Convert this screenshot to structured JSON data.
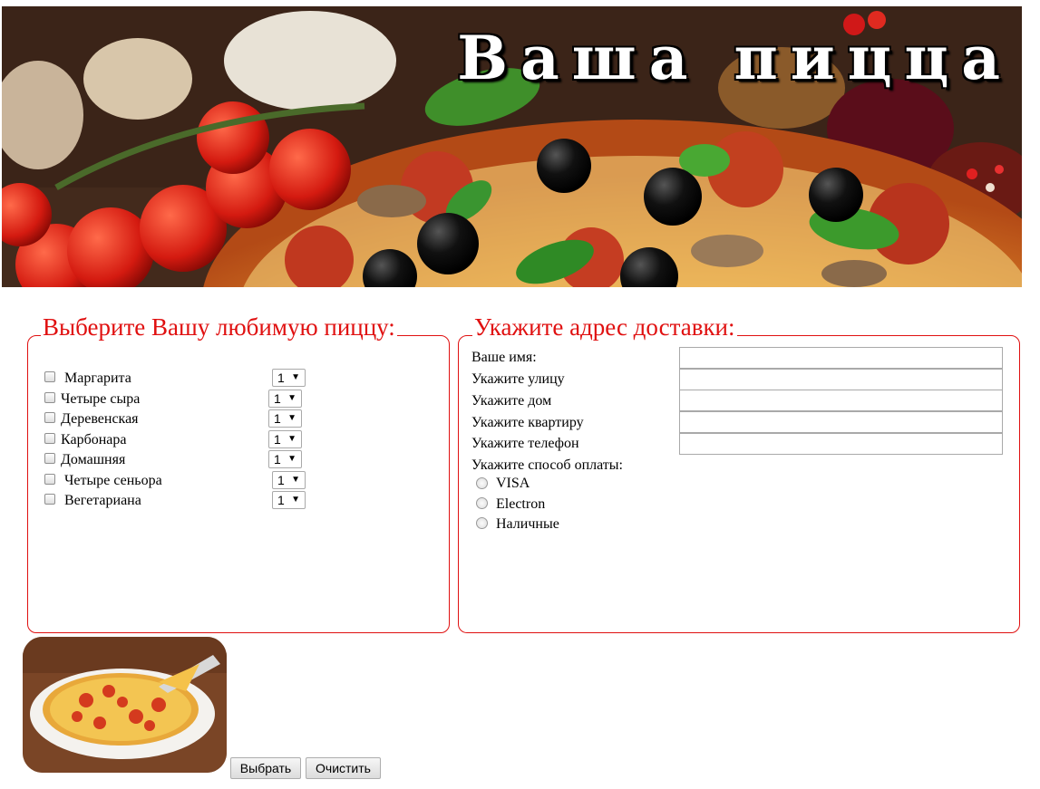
{
  "banner": {
    "title": "Ваша пицца"
  },
  "pizza_section": {
    "legend": "Выберите Вашу любимую пиццу:",
    "items": [
      {
        "name": "Маргарита",
        "quantity": "1"
      },
      {
        "name": "Четыре сыра",
        "quantity": "1"
      },
      {
        "name": "Деревенская",
        "quantity": "1"
      },
      {
        "name": "Карбонара",
        "quantity": "1"
      },
      {
        "name": "Домашняя",
        "quantity": "1"
      },
      {
        "name": "Четыре сеньора",
        "quantity": "1"
      },
      {
        "name": "Вегетариана",
        "quantity": "1"
      }
    ]
  },
  "address_section": {
    "legend": "Укажите адрес доставки:",
    "fields": [
      {
        "label": "Ваше имя:",
        "value": ""
      },
      {
        "label": "Укажите улицу",
        "value": ""
      },
      {
        "label": "Укажите дом",
        "value": ""
      },
      {
        "label": "Укажите квартиру",
        "value": ""
      },
      {
        "label": "Укажите телефон",
        "value": ""
      }
    ],
    "payment_label": "Укажите способ оплаты:",
    "payment_options": [
      "VISA",
      "Electron",
      "Наличные"
    ]
  },
  "buttons": {
    "select": "Выбрать",
    "clear": "Очистить"
  },
  "colors": {
    "accent": "#e01010"
  }
}
